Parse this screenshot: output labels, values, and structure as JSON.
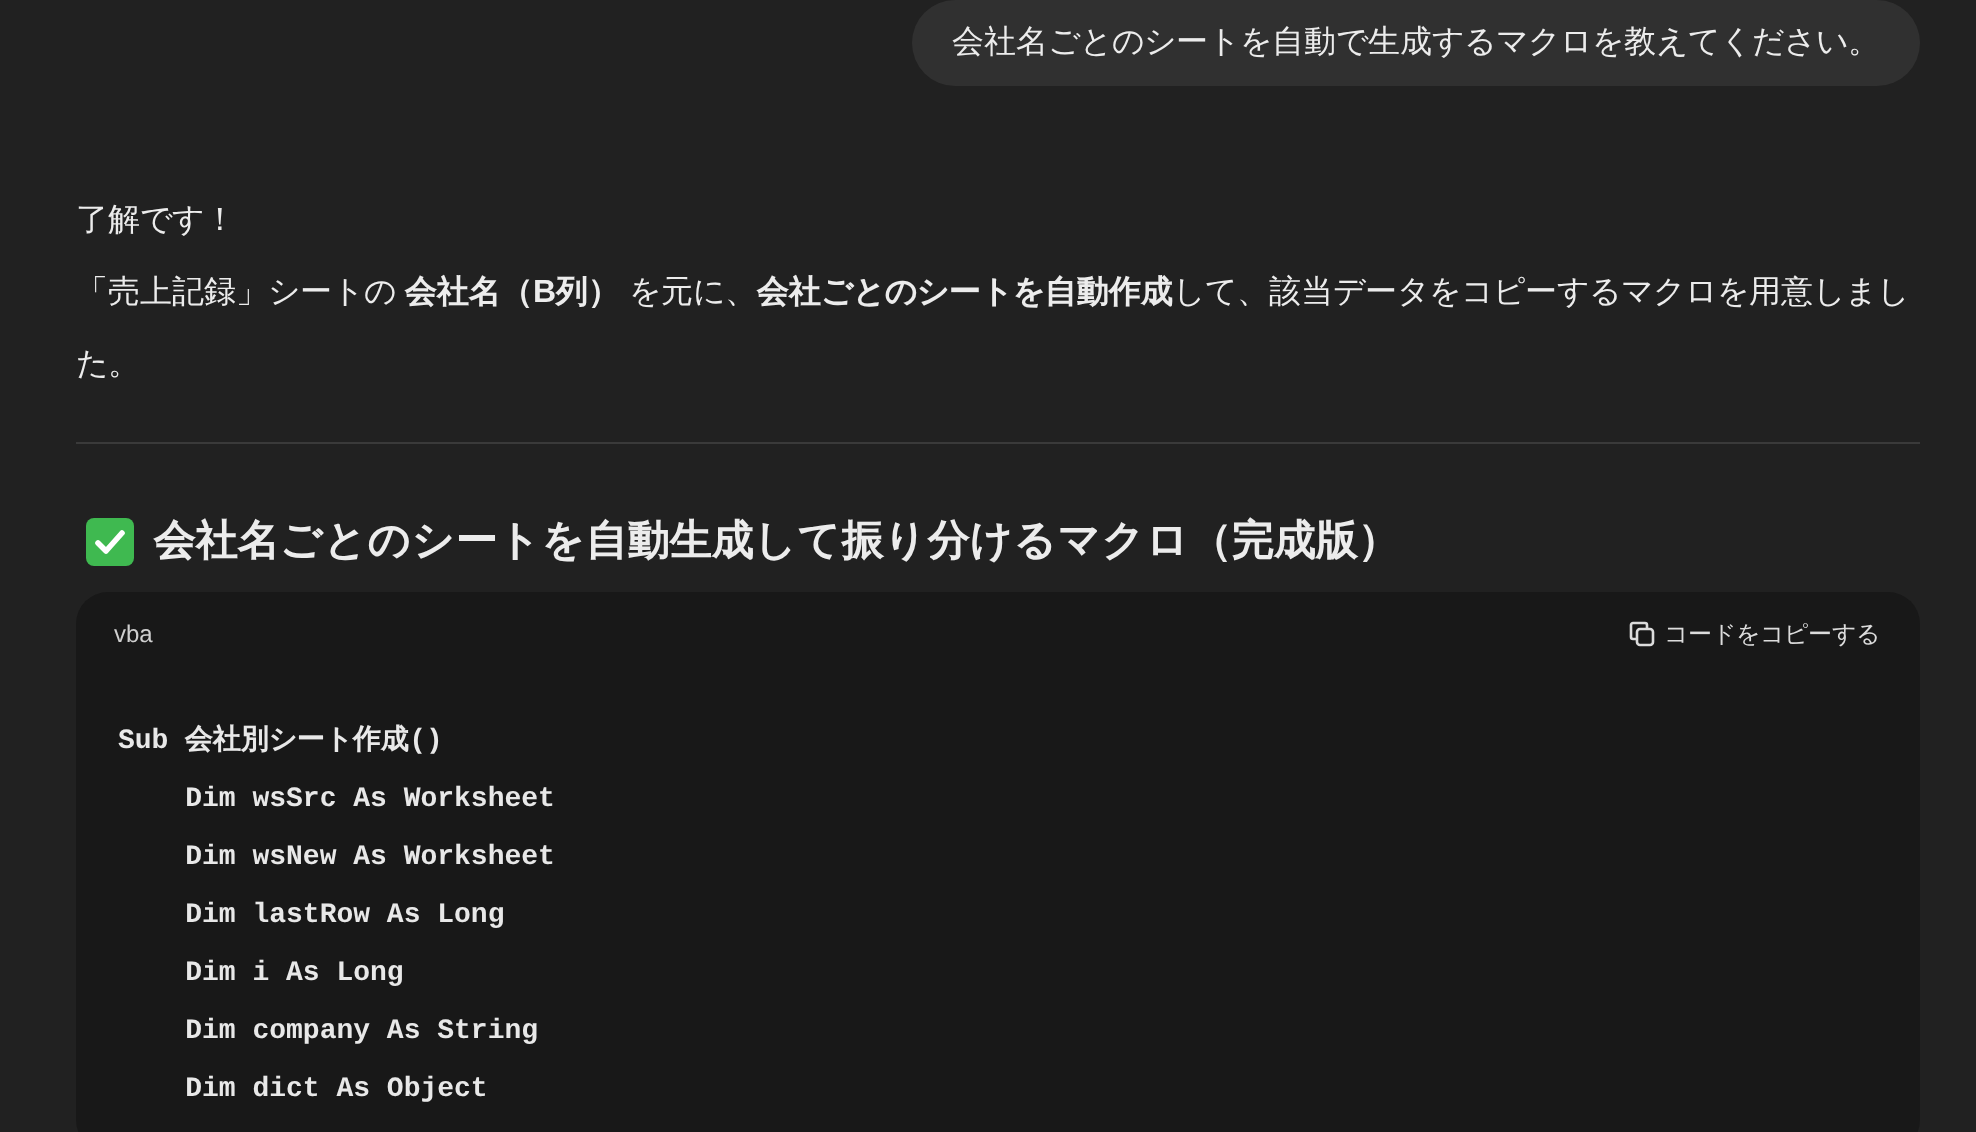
{
  "user_message": "会社名ごとのシートを自動で生成するマクロを教えてください。",
  "assistant": {
    "paragraphs": [
      "了解です！",
      "「売上記録」シートの **会社名（B列）** を元に、**会社ごとのシートを自動作成**して、該当データをコピーするマクロを用意しました。"
    ],
    "heading": {
      "checked": true,
      "text": "会社名ごとのシートを自動生成して振り分けるマクロ（完成版）"
    },
    "code_block": {
      "language": "vba",
      "copy_button": "コードをコピーする",
      "lines": [
        "Sub 会社別シート作成()",
        "    Dim wsSrc As Worksheet",
        "    Dim wsNew As Worksheet",
        "    Dim lastRow As Long",
        "    Dim i As Long",
        "    Dim company As String",
        "    Dim dict As Object"
      ]
    }
  }
}
